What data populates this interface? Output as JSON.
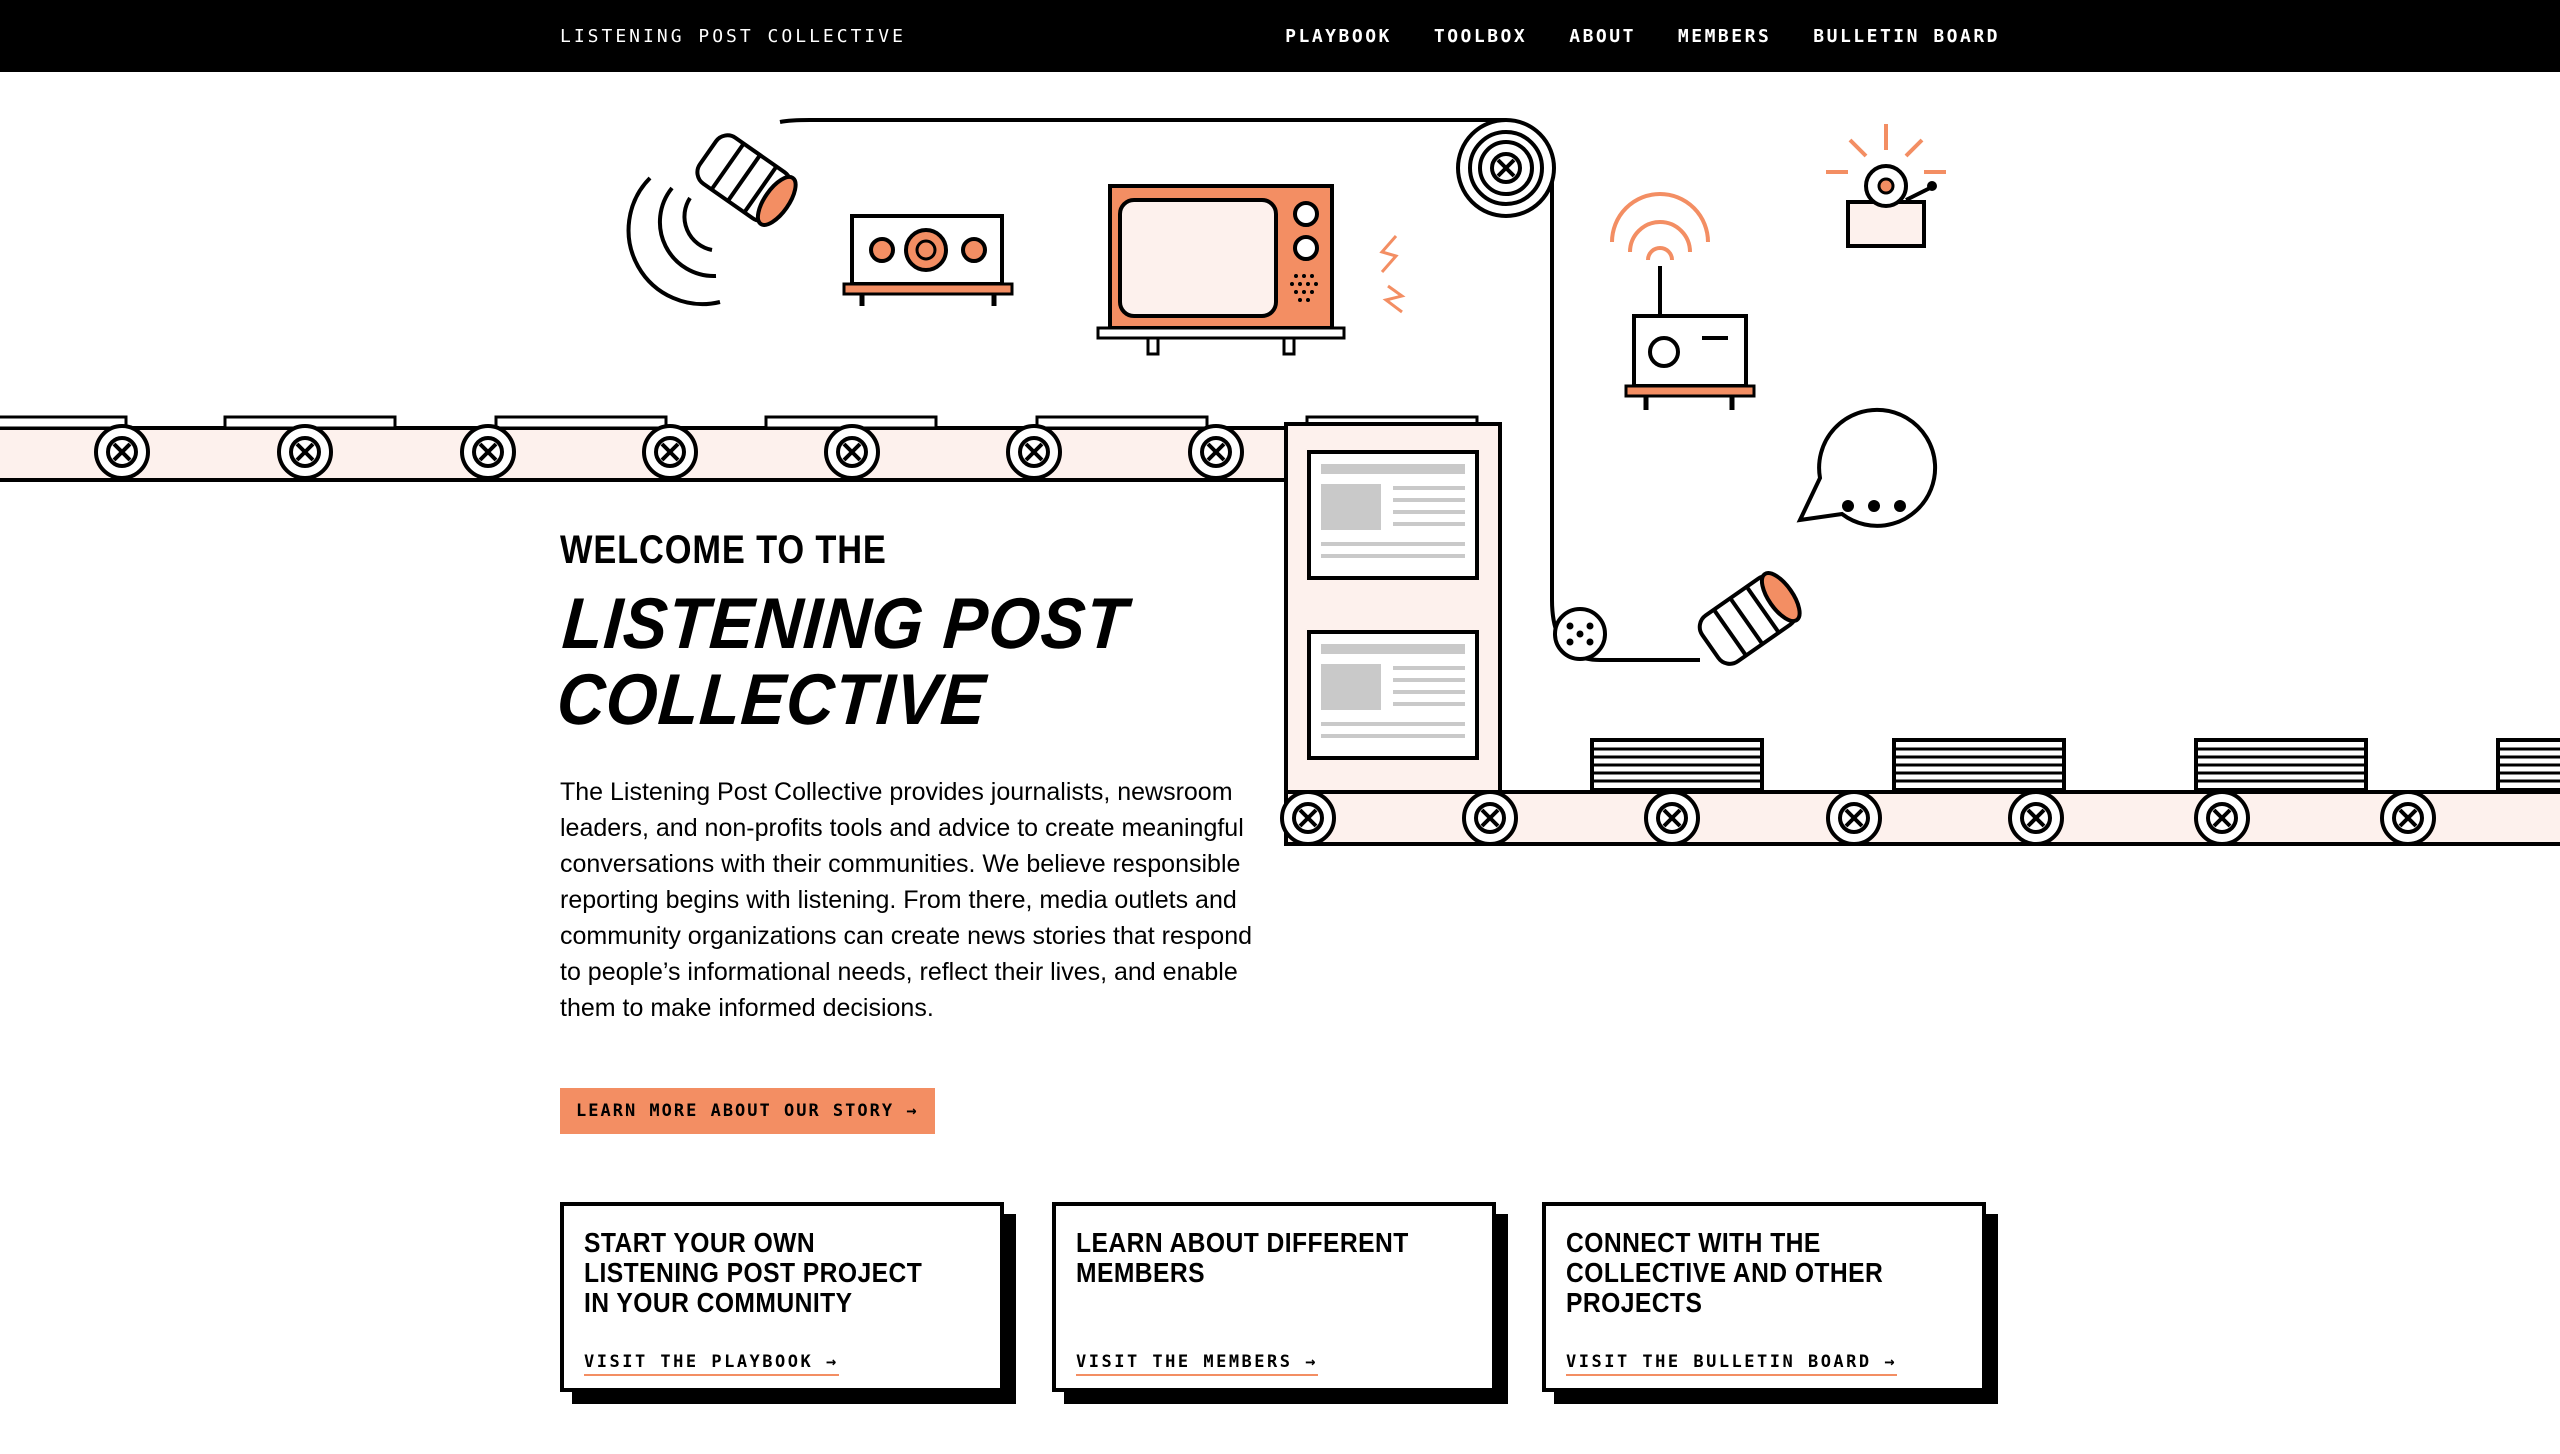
{
  "header": {
    "brand": "LISTENING POST COLLECTIVE",
    "nav": [
      "PLAYBOOK",
      "TOOLBOX",
      "ABOUT",
      "MEMBERS",
      "BULLETIN BOARD"
    ]
  },
  "hero": {
    "kicker": "WELCOME TO THE",
    "title": "LISTENING POST COLLECTIVE",
    "body": "The Listening Post Collective provides journalists, newsroom leaders, and non-profits tools and advice to create meaningful conversations with their communities. We believe responsible reporting begins with listening. From there, media outlets and community organizations can create news stories that respond to people’s informational needs, reflect their lives, and enable them to make informed decisions.",
    "cta": "LEARN MORE ABOUT OUR STORY →"
  },
  "cards": [
    {
      "title": "START YOUR OWN LISTENING POST PROJECT IN YOUR COMMUNITY",
      "link": "VISIT THE PLAYBOOK →"
    },
    {
      "title": "LEARN ABOUT DIFFERENT MEMBERS",
      "link": "VISIT THE MEMBERS →"
    },
    {
      "title": "CONNECT WITH THE COLLECTIVE AND OTHER PROJECTS",
      "link": "VISIT THE BULLETIN BOARD →"
    }
  ],
  "colors": {
    "accent": "#f38e63",
    "belt": "#fdf1ed",
    "ink": "#000000"
  },
  "icons": [
    "tin-can-phone-icon",
    "radio-icon",
    "television-icon",
    "pulley-icon",
    "antenna-radio-icon",
    "bell-icon",
    "speech-bubble-icon",
    "newspaper-icon",
    "newspaper-stack-icon",
    "roller-icon"
  ]
}
